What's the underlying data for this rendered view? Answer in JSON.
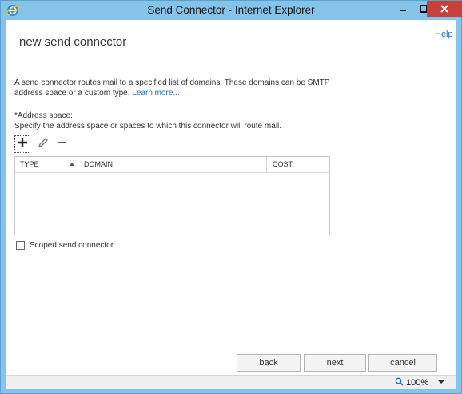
{
  "window": {
    "title": "Send Connector - Internet Explorer",
    "accent_color": "#86c3e8",
    "close_color": "#c7403a"
  },
  "page": {
    "help_label": "Help",
    "title": "new send connector",
    "description_text": "A send connector routes mail to a specified list of domains. These domains can be SMTP address space or a custom type.",
    "learn_more_label": "Learn more...",
    "address_space_label": "*Address space:",
    "address_space_help": "Specify the address space or spaces to which this connector will route mail."
  },
  "toolbar": {
    "add_icon": "plus-icon",
    "edit_icon": "pencil-icon",
    "remove_icon": "minus-icon"
  },
  "grid": {
    "columns": [
      "TYPE",
      "DOMAIN",
      "COST"
    ],
    "sort_column": "TYPE",
    "sort_direction": "ascending",
    "rows": []
  },
  "scoped": {
    "label": "Scoped send connector",
    "checked": false
  },
  "buttons": {
    "back": "back",
    "next": "next",
    "cancel": "cancel"
  },
  "status": {
    "zoom": "100%"
  }
}
